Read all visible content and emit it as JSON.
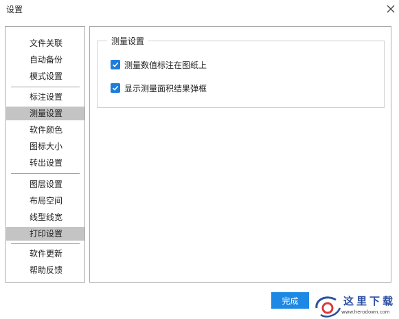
{
  "window": {
    "title": "设置",
    "close_icon": "close-icon"
  },
  "sidebar": {
    "items": [
      {
        "label": "文件关联",
        "active": false
      },
      {
        "label": "自动备份",
        "active": false
      },
      {
        "label": "模式设置",
        "active": false
      },
      {
        "label": "标注设置",
        "active": false
      },
      {
        "label": "测量设置",
        "active": true
      },
      {
        "label": "软件颜色",
        "active": false
      },
      {
        "label": "图标大小",
        "active": false
      },
      {
        "label": "转出设置",
        "active": false
      },
      {
        "label": "图层设置",
        "active": false
      },
      {
        "label": "布局空间",
        "active": false
      },
      {
        "label": "线型线宽",
        "active": false
      },
      {
        "label": "打印设置",
        "active": false
      },
      {
        "label": "软件更新",
        "active": false
      },
      {
        "label": "帮助反馈",
        "active": false
      }
    ]
  },
  "group": {
    "title": "测量设置",
    "options": [
      {
        "label": "测量数值标注在图纸上",
        "checked": true
      },
      {
        "label": "显示测量面积结果弹框",
        "checked": true
      }
    ]
  },
  "footer": {
    "done_label": "完成"
  },
  "watermark": {
    "text": "这里下载",
    "url": "www.herodown.com"
  },
  "colors": {
    "accent": "#1e88e5",
    "checkbox": "#1e7ddb",
    "sidebar_active": "#c4c4c4"
  }
}
